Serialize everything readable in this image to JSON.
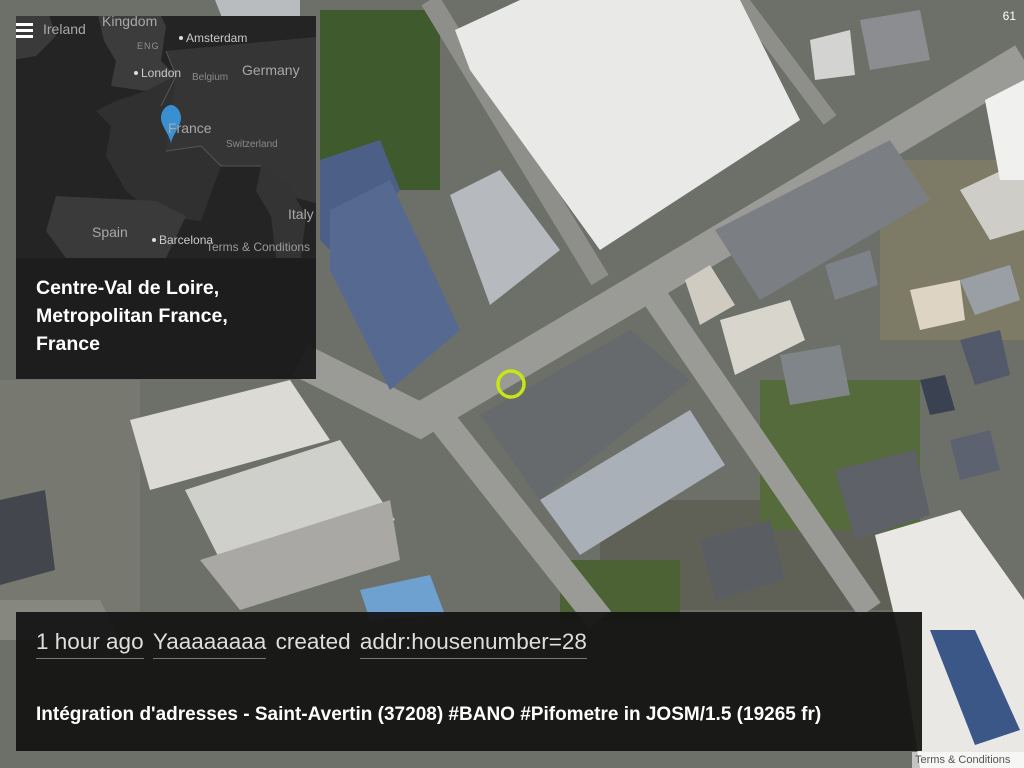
{
  "counter": "61",
  "overview": {
    "menu_icon": "hamburger-menu-icon",
    "marker_icon": "map-pin-icon",
    "marker_color": "#3a8fd0",
    "labels": {
      "ireland": "Ireland",
      "kingdom": "Kingdom",
      "eng": "ENG",
      "london": "London",
      "amsterdam": "Amsterdam",
      "belgium": "Belgium",
      "germany": "Germany",
      "france": "France",
      "switzerland": "Switzerland",
      "italy": "Italy",
      "spain": "Spain",
      "barcelona": "Barcelona"
    },
    "terms": "Terms & Conditions",
    "region": "Centre-Val de Loire, Metropolitan France, France"
  },
  "edit": {
    "time": "1 hour ago",
    "user": "Yaaaaaaaa",
    "action": "created",
    "tag": "addr:housenumber=28",
    "comment": "Intégration d'adresses - Saint-Avertin (37208) #BANO #Pifometre in JOSM/1.5 (19265 fr)"
  },
  "map": {
    "highlight_color": "#c8e614",
    "terms": "Terms & Conditions"
  }
}
